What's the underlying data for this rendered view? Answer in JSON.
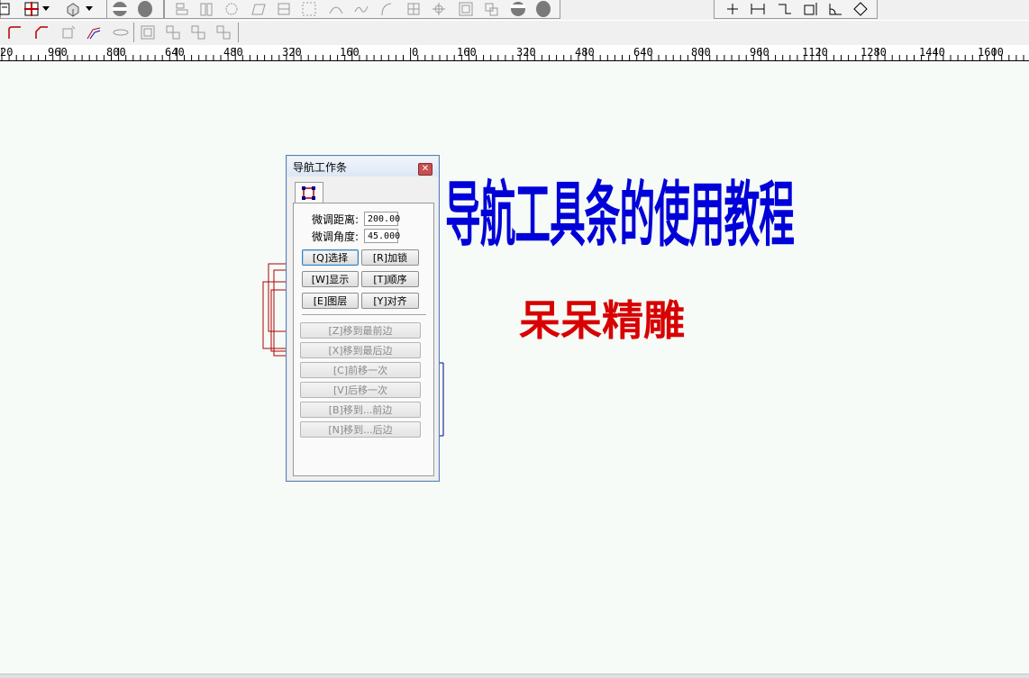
{
  "ruler": {
    "labels": [
      "20",
      "960",
      "800",
      "640",
      "480",
      "320",
      "160",
      "0",
      "160",
      "320",
      "480",
      "640",
      "800",
      "960",
      "1120",
      "1280",
      "1440",
      "1600"
    ]
  },
  "canvas": {
    "title": "导航工具条的使用教程",
    "subtitle": "呆呆精雕",
    "colors": {
      "title": "#0000d8",
      "subtitle": "#d80000",
      "background": "#f6fbf7"
    }
  },
  "nav_panel": {
    "title": "导航工作条",
    "close_icon": "close-icon",
    "tab_icon": "select-node-icon",
    "fine_distance_label": "微调距离:",
    "fine_distance_value": "200.00",
    "fine_angle_label": "微调角度:",
    "fine_angle_value": "45.000",
    "buttons": {
      "select": "[Q]选择",
      "lock": "[R]加锁",
      "show": "[W]显示",
      "order": "[T]顺序",
      "layer": "[E]图层",
      "align": "[Y]对齐"
    },
    "actions": {
      "to_front": "[Z]移到最前边",
      "to_back": "[X]移到最后边",
      "forward_one": "[C]前移一次",
      "backward_one": "[V]后移一次",
      "before": "[B]移到...前边",
      "after": "[N]移到...后边"
    }
  }
}
